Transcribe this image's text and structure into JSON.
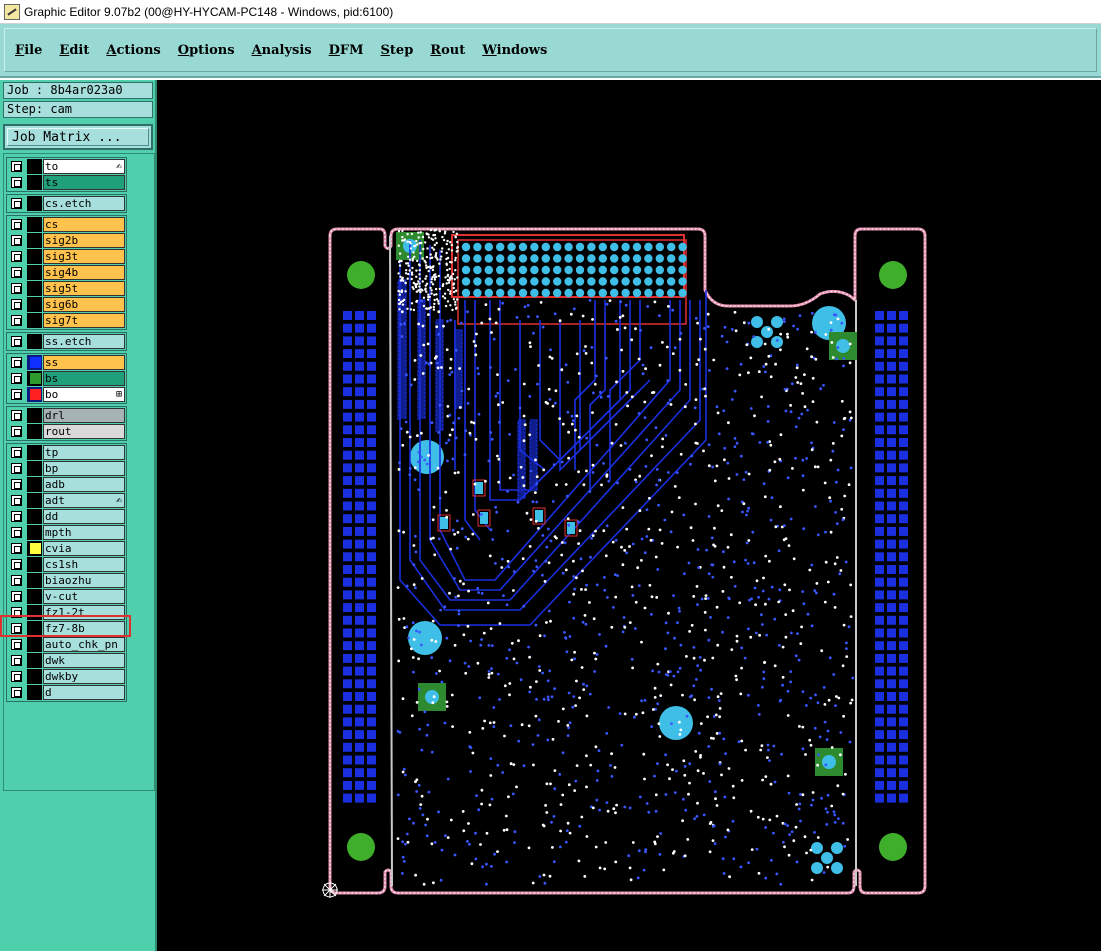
{
  "window": {
    "title": "Graphic Editor 9.07b2 (00@HY-HYCAM-PC148 - Windows, pid:6100)"
  },
  "menu": [
    {
      "label": "File",
      "u": "F",
      "rest": "ile"
    },
    {
      "label": "Edit",
      "u": "E",
      "rest": "dit"
    },
    {
      "label": "Actions",
      "u": "A",
      "rest": "ctions"
    },
    {
      "label": "Options",
      "u": "O",
      "rest": "ptions"
    },
    {
      "label": "Analysis",
      "u": "A",
      "rest": "nalysis"
    },
    {
      "label": "DFM",
      "u": "D",
      "rest": "FM"
    },
    {
      "label": "Step",
      "u": "S",
      "rest": "tep"
    },
    {
      "label": "Rout",
      "u": "R",
      "rest": "out"
    },
    {
      "label": "Windows",
      "u": "W",
      "rest": "indows"
    }
  ],
  "job": {
    "label": "Job : 8b4ar023a0",
    "step": "Step: cam",
    "matrix_button": "Job Matrix ..."
  },
  "layers": [
    {
      "name": "to",
      "style": "white",
      "color": "#000000",
      "mark": "✍"
    },
    {
      "name": "ts",
      "style": "green",
      "color": "#000000"
    },
    {
      "name": "cs.etch",
      "style": "",
      "color": "#000000"
    },
    {
      "name": "cs",
      "style": "orange",
      "color": "#000000"
    },
    {
      "name": "sig2b",
      "style": "orange",
      "color": "#000000"
    },
    {
      "name": "sig3t",
      "style": "orange",
      "color": "#000000"
    },
    {
      "name": "sig4b",
      "style": "orange",
      "color": "#000000"
    },
    {
      "name": "sig5t",
      "style": "orange",
      "color": "#000000"
    },
    {
      "name": "sig6b",
      "style": "orange",
      "color": "#000000"
    },
    {
      "name": "sig7t",
      "style": "orange",
      "color": "#000000"
    },
    {
      "name": "ss.etch",
      "style": "",
      "color": "#000000"
    },
    {
      "name": "ss",
      "style": "orange",
      "color": "#1030ff"
    },
    {
      "name": "bs",
      "style": "green",
      "color": "#2e9a2e"
    },
    {
      "name": "bo",
      "style": "white",
      "color": "#ff2020",
      "mark": "⊞"
    },
    {
      "name": "drl",
      "style": "gray",
      "color": "#000000"
    },
    {
      "name": "rout",
      "style": "lgray",
      "color": "#000000"
    },
    {
      "name": "tp",
      "style": "",
      "color": "#000000"
    },
    {
      "name": "bp",
      "style": "",
      "color": "#000000"
    },
    {
      "name": "adb",
      "style": "",
      "color": "#000000"
    },
    {
      "name": "adt",
      "style": "",
      "color": "#000000",
      "mark": "✍"
    },
    {
      "name": "dd",
      "style": "",
      "color": "#000000"
    },
    {
      "name": "mpth",
      "style": "",
      "color": "#000000"
    },
    {
      "name": "cvia",
      "style": "",
      "color": "#ffff40"
    },
    {
      "name": "cs1sh",
      "style": "",
      "color": "#000000"
    },
    {
      "name": "biaozhu",
      "style": "",
      "color": "#000000"
    },
    {
      "name": "v-cut",
      "style": "",
      "color": "#000000"
    },
    {
      "name": "fz1-2t",
      "style": "",
      "color": "#000000"
    },
    {
      "name": "fz7-8b",
      "style": "",
      "color": "#000000"
    },
    {
      "name": "auto_chk_pn",
      "style": "",
      "color": "#000000"
    },
    {
      "name": "dwk",
      "style": "",
      "color": "#000000"
    },
    {
      "name": "dwkby",
      "style": "",
      "color": "#000000"
    },
    {
      "name": "d",
      "style": "",
      "color": "#000000"
    }
  ],
  "colors": {
    "board_outline": "#e38fb0",
    "trace": "#1a2fe0",
    "pad": "#3fbfe8",
    "fiducial": "#3fae2b",
    "via": "#ffffff",
    "selection": "#e03030"
  }
}
